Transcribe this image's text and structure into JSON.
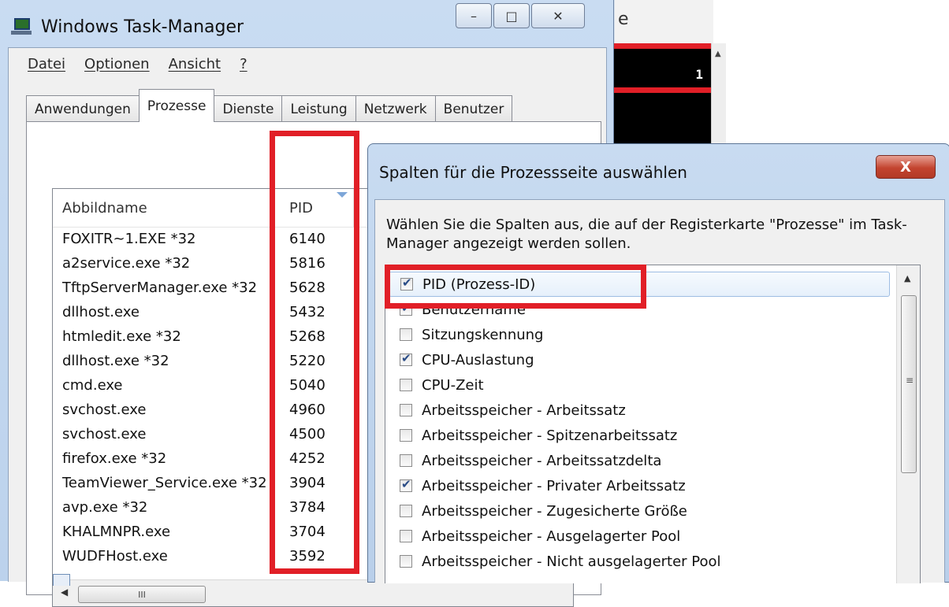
{
  "task_manager": {
    "title": "Windows Task-Manager",
    "window_buttons": {
      "minimize": "–",
      "maximize": "□",
      "close": "✕"
    },
    "menu": [
      "Datei",
      "Optionen",
      "Ansicht",
      "?"
    ],
    "tabs": [
      "Anwendungen",
      "Prozesse",
      "Dienste",
      "Leistung",
      "Netzwerk",
      "Benutzer"
    ],
    "active_tab": "Prozesse",
    "columns": [
      "Abbildname",
      "PID"
    ],
    "processes": [
      {
        "name": "FOXITR~1.EXE *32",
        "pid": "6140"
      },
      {
        "name": "a2service.exe *32",
        "pid": "5816"
      },
      {
        "name": "TftpServerManager.exe *32",
        "pid": "5628"
      },
      {
        "name": "dllhost.exe",
        "pid": "5432"
      },
      {
        "name": "htmledit.exe *32",
        "pid": "5268"
      },
      {
        "name": "dllhost.exe *32",
        "pid": "5220"
      },
      {
        "name": "cmd.exe",
        "pid": "5040"
      },
      {
        "name": "svchost.exe",
        "pid": "4960"
      },
      {
        "name": "svchost.exe",
        "pid": "4500"
      },
      {
        "name": "firefox.exe *32",
        "pid": "4252"
      },
      {
        "name": "TeamViewer_Service.exe *32",
        "pid": "3904"
      },
      {
        "name": "avp.exe *32",
        "pid": "3784"
      },
      {
        "name": "KHALMNPR.exe",
        "pid": "3704"
      },
      {
        "name": "WUDFHost.exe",
        "pid": "3592"
      }
    ],
    "hscroll_grip": "III"
  },
  "console": {
    "value": "1"
  },
  "dialog": {
    "title": "Spalten für die Prozessseite auswählen",
    "close_glyph": "X",
    "description": "Wählen Sie die Spalten aus, die auf der Registerkarte \"Prozesse\" im Task-Manager angezeigt werden sollen.",
    "options": [
      {
        "label": "PID (Prozess-ID)",
        "checked": true
      },
      {
        "label": "Benutzername",
        "checked": true
      },
      {
        "label": "Sitzungskennung",
        "checked": false
      },
      {
        "label": "CPU-Auslastung",
        "checked": true
      },
      {
        "label": "CPU-Zeit",
        "checked": false
      },
      {
        "label": "Arbeitsspeicher - Arbeitssatz",
        "checked": false
      },
      {
        "label": "Arbeitsspeicher - Spitzenarbeitssatz",
        "checked": false
      },
      {
        "label": "Arbeitsspeicher - Arbeitssatzdelta",
        "checked": false
      },
      {
        "label": "Arbeitsspeicher - Privater Arbeitssatz",
        "checked": true
      },
      {
        "label": "Arbeitsspeicher - Zugesicherte Größe",
        "checked": false
      },
      {
        "label": "Arbeitsspeicher - Ausgelagerter Pool",
        "checked": false
      },
      {
        "label": "Arbeitsspeicher - Nicht ausgelagerter Pool",
        "checked": false
      }
    ],
    "scroll_grip": "≡"
  },
  "colors": {
    "highlight_red": "#e11f27",
    "titlebar_blue": "#c9dcf2"
  }
}
